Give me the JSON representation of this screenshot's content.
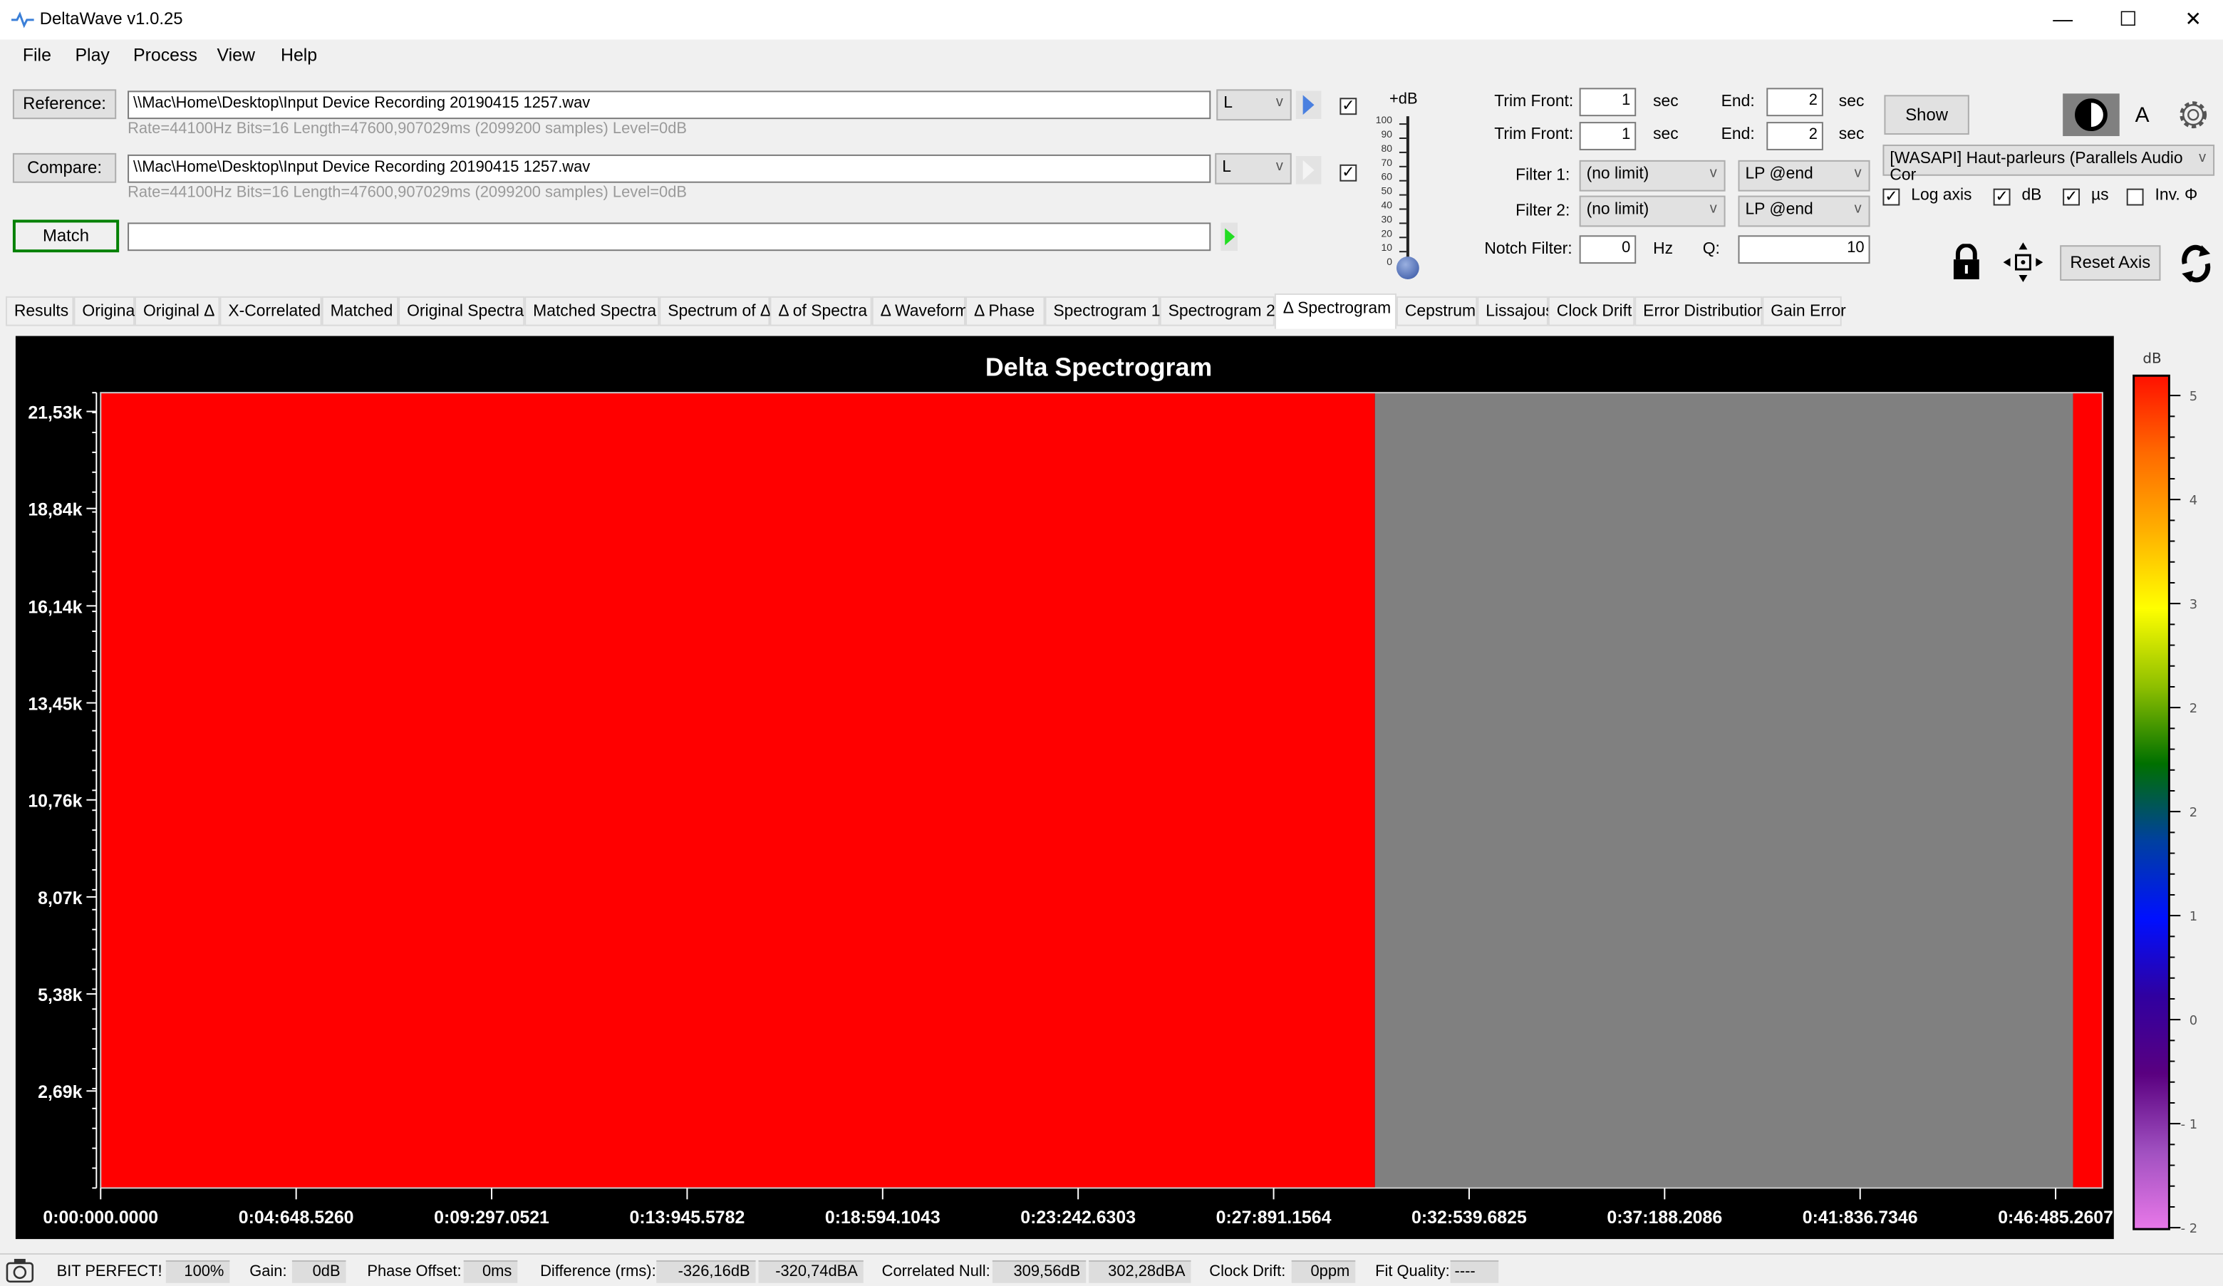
{
  "window": {
    "title": "DeltaWave v1.0.25",
    "minimize": "—",
    "maximize": "☐",
    "close": "✕"
  },
  "menu": [
    "File",
    "Play",
    "Process",
    "View",
    "Help"
  ],
  "files": {
    "reference": {
      "button": "Reference:",
      "path": "\\\\Mac\\Home\\Desktop\\Input Device Recording 20190415 1257.wav",
      "info": "Rate=44100Hz Bits=16 Length=47600,907029ms (2099200 samples) Level=0dB",
      "channel": "L",
      "checked": true
    },
    "compare": {
      "button": "Compare:",
      "path": "\\\\Mac\\Home\\Desktop\\Input Device Recording 20190415 1257.wav",
      "info": "Rate=44100Hz Bits=16 Length=47600,907029ms (2099200 samples) Level=0dB",
      "channel": "L",
      "checked": true
    },
    "match": {
      "button": "Match",
      "value": ""
    }
  },
  "level_slider": {
    "label": "+dB",
    "ticks": [
      "100",
      "90",
      "80",
      "70",
      "60",
      "50",
      "40",
      "30",
      "20",
      "10",
      "0"
    ],
    "value": 0
  },
  "trim": [
    {
      "label": "Trim Front:",
      "front": "1",
      "unit": "sec",
      "end_label": "End:",
      "end": "2",
      "end_unit": "sec"
    },
    {
      "label": "Trim Front:",
      "front": "1",
      "unit": "sec",
      "end_label": "End:",
      "end": "2",
      "end_unit": "sec"
    }
  ],
  "filters": [
    {
      "label": "Filter 1:",
      "value": "(no limit)",
      "mode": "LP @end"
    },
    {
      "label": "Filter 2:",
      "value": "(no limit)",
      "mode": "LP @end"
    }
  ],
  "notch": {
    "label": "Notch Filter:",
    "value": "0",
    "unit": "Hz",
    "q_label": "Q:",
    "q": "10"
  },
  "right_panel": {
    "show": "Show",
    "font_a": "A",
    "device": "[WASAPI] Haut-parleurs (Parallels Audio Cor",
    "reset_axis": "Reset Axis",
    "options": [
      {
        "label": "Log axis",
        "checked": true
      },
      {
        "label": "dB",
        "checked": true
      },
      {
        "label": "µs",
        "checked": true
      },
      {
        "label": "Inv. Φ",
        "checked": false
      }
    ]
  },
  "tabs": [
    "Results",
    "Original",
    "Original Δ",
    "X-Correlated",
    "Matched",
    "Original Spectra",
    "Matched Spectra",
    "Spectrum of Δ",
    "Δ of Spectra",
    "Δ Waveform",
    "Δ Phase",
    "Spectrogram 1",
    "Spectrogram 2",
    "Δ Spectrogram",
    "Cepstrum",
    "Lissajous",
    "Clock Drift",
    "Error Distribution",
    "Gain Error"
  ],
  "active_tab": "Δ Spectrogram",
  "chart_data": {
    "type": "heatmap",
    "title": "Delta Spectrogram",
    "x_tick_labels": [
      "0:00:000.0000",
      "0:04:648.5260",
      "0:09:297.0521",
      "0:13:945.5782",
      "0:18:594.1043",
      "0:23:242.6303",
      "0:27:891.1564",
      "0:32:539.6825",
      "0:37:188.2086",
      "0:41:836.7346",
      "0:46:485.2607"
    ],
    "x_ticks_sec": [
      0,
      4.6485,
      9.2971,
      13.9456,
      18.5941,
      23.2426,
      27.8912,
      32.5397,
      37.1882,
      41.8367,
      46.4853
    ],
    "xlim_sec": [
      0,
      47.6
    ],
    "y_tick_labels": [
      "21,53k",
      "18,84k",
      "16,14k",
      "13,45k",
      "10,76k",
      "8,07k",
      "5,38k",
      "2,69k"
    ],
    "y_ticks_hz": [
      21530,
      18840,
      16140,
      13450,
      10760,
      8070,
      5380,
      2690
    ],
    "ylim_hz": [
      0,
      22050
    ],
    "regions": [
      {
        "t_start": 0,
        "t_end": 30.3,
        "value_db": 5,
        "color": "#ff0000"
      },
      {
        "t_start": 30.3,
        "t_end": 46.9,
        "value_db": null,
        "color": "#808080"
      },
      {
        "t_start": 46.9,
        "t_end": 47.6,
        "value_db": 5,
        "color": "#ff0000"
      }
    ],
    "colorbar": {
      "label": "dB",
      "tick_labels": [
        "5",
        "4",
        "3",
        "2",
        "2",
        "1",
        "0",
        "- 1",
        "- 2"
      ],
      "range": [
        -2,
        5
      ],
      "colors": [
        "#ff1000",
        "#ff6a00",
        "#ffb000",
        "#ffff00",
        "#8fc000",
        "#007000",
        "#0040a0",
        "#0010ff",
        "#3000a0",
        "#5a0080",
        "#a050c0",
        "#e878e8"
      ]
    }
  },
  "status": {
    "bit_perfect": "BIT PERFECT!",
    "bit_pct": "100%",
    "gain_label": "Gain:",
    "gain": "0dB",
    "phase_label": "Phase Offset:",
    "phase": "0ms",
    "diff_label": "Difference (rms):",
    "diff_db": "-326,16dB",
    "diff_dba": "-320,74dBA",
    "null_label": "Correlated Null:",
    "null_db": "309,56dB",
    "null_dba": "302,28dBA",
    "drift_label": "Clock Drift:",
    "drift": "0ppm",
    "fit_label": "Fit Quality:",
    "fit": "----"
  }
}
